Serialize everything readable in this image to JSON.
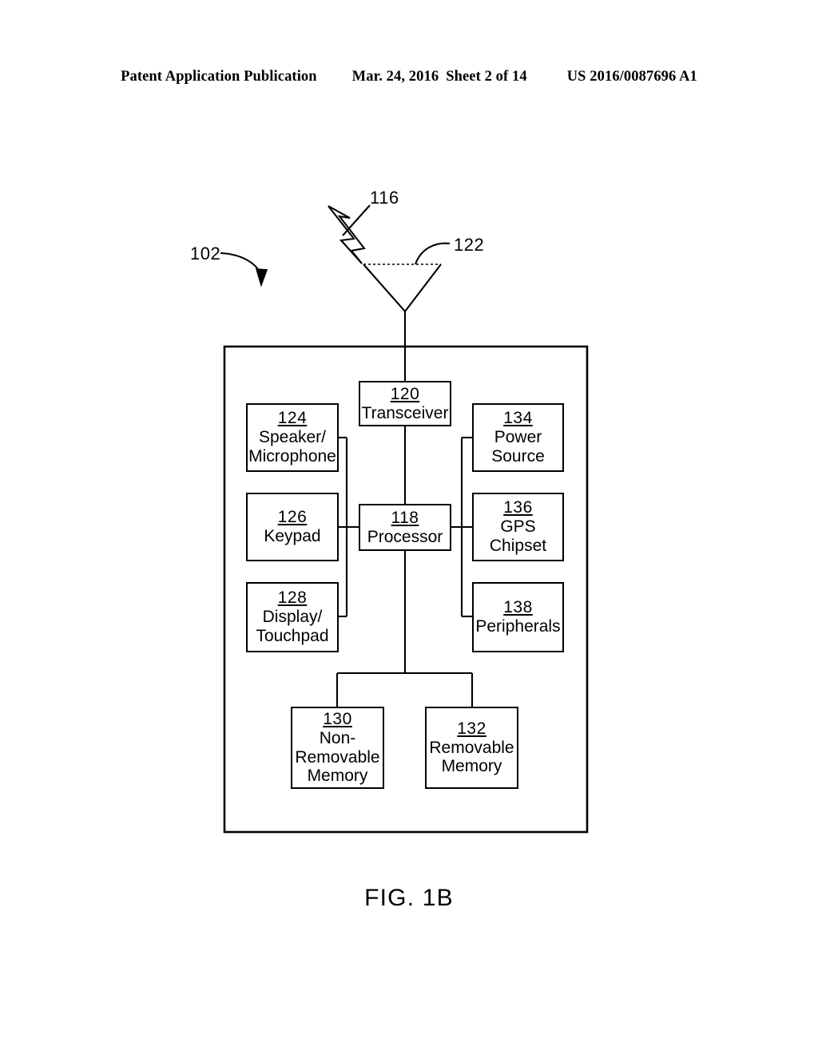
{
  "header": {
    "publication": "Patent Application Publication",
    "date": "Mar. 24, 2016",
    "sheet": "Sheet 2 of 14",
    "patent_number": "US 2016/0087696 A1"
  },
  "figure": {
    "caption": "FIG. 1B",
    "callouts": [
      {
        "id": "102",
        "label": "102"
      },
      {
        "id": "116",
        "label": "116"
      },
      {
        "id": "122",
        "label": "122"
      }
    ],
    "blocks": [
      {
        "id": "transceiver",
        "ref": "120",
        "label": "Transceiver"
      },
      {
        "id": "speaker",
        "ref": "124",
        "label": "Speaker/\nMicrophone"
      },
      {
        "id": "power",
        "ref": "134",
        "label": "Power\nSource"
      },
      {
        "id": "keypad",
        "ref": "126",
        "label": "Keypad"
      },
      {
        "id": "processor",
        "ref": "118",
        "label": "Processor"
      },
      {
        "id": "gps",
        "ref": "136",
        "label": "GPS\nChipset"
      },
      {
        "id": "display",
        "ref": "128",
        "label": "Display/\nTouchpad"
      },
      {
        "id": "peripherals",
        "ref": "138",
        "label": "Peripherals"
      },
      {
        "id": "nonremov",
        "ref": "130",
        "label": "Non-\nRemovable\nMemory"
      },
      {
        "id": "removable",
        "ref": "132",
        "label": "Removable\nMemory"
      }
    ],
    "colors": {
      "line": "#000000",
      "background": "#ffffff"
    }
  }
}
